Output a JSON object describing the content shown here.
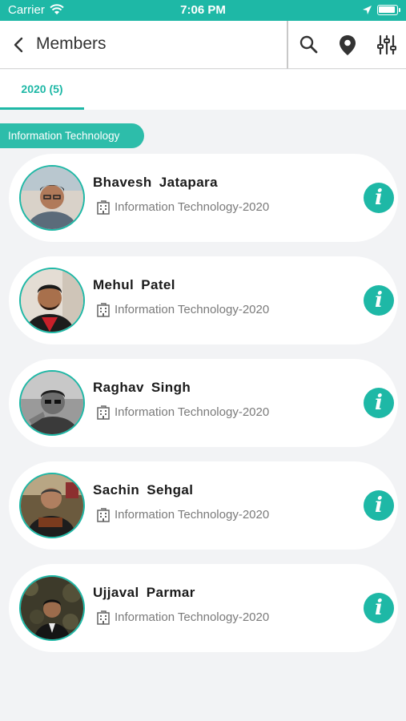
{
  "status_bar": {
    "carrier": "Carrier",
    "time": "7:06 PM"
  },
  "nav": {
    "title": "Members",
    "back_icon": "chevron-left-icon",
    "actions": [
      "search-icon",
      "map-pin-icon",
      "filter-sliders-icon"
    ]
  },
  "tabs": [
    {
      "label": "2020 (5)",
      "active": true
    }
  ],
  "group": {
    "title": "Information Technology"
  },
  "members": [
    {
      "name": "Bhavesh  Jatapara",
      "department": "Information Technology-2020"
    },
    {
      "name": "Mehul  Patel",
      "department": "Information Technology-2020"
    },
    {
      "name": "Raghav  Singh",
      "department": "Information Technology-2020"
    },
    {
      "name": "Sachin  Sehgal",
      "department": "Information Technology-2020"
    },
    {
      "name": "Ujjaval  Parmar",
      "department": "Information Technology-2020"
    }
  ],
  "colors": {
    "accent": "#1eb8a6",
    "background": "#f2f3f5"
  }
}
